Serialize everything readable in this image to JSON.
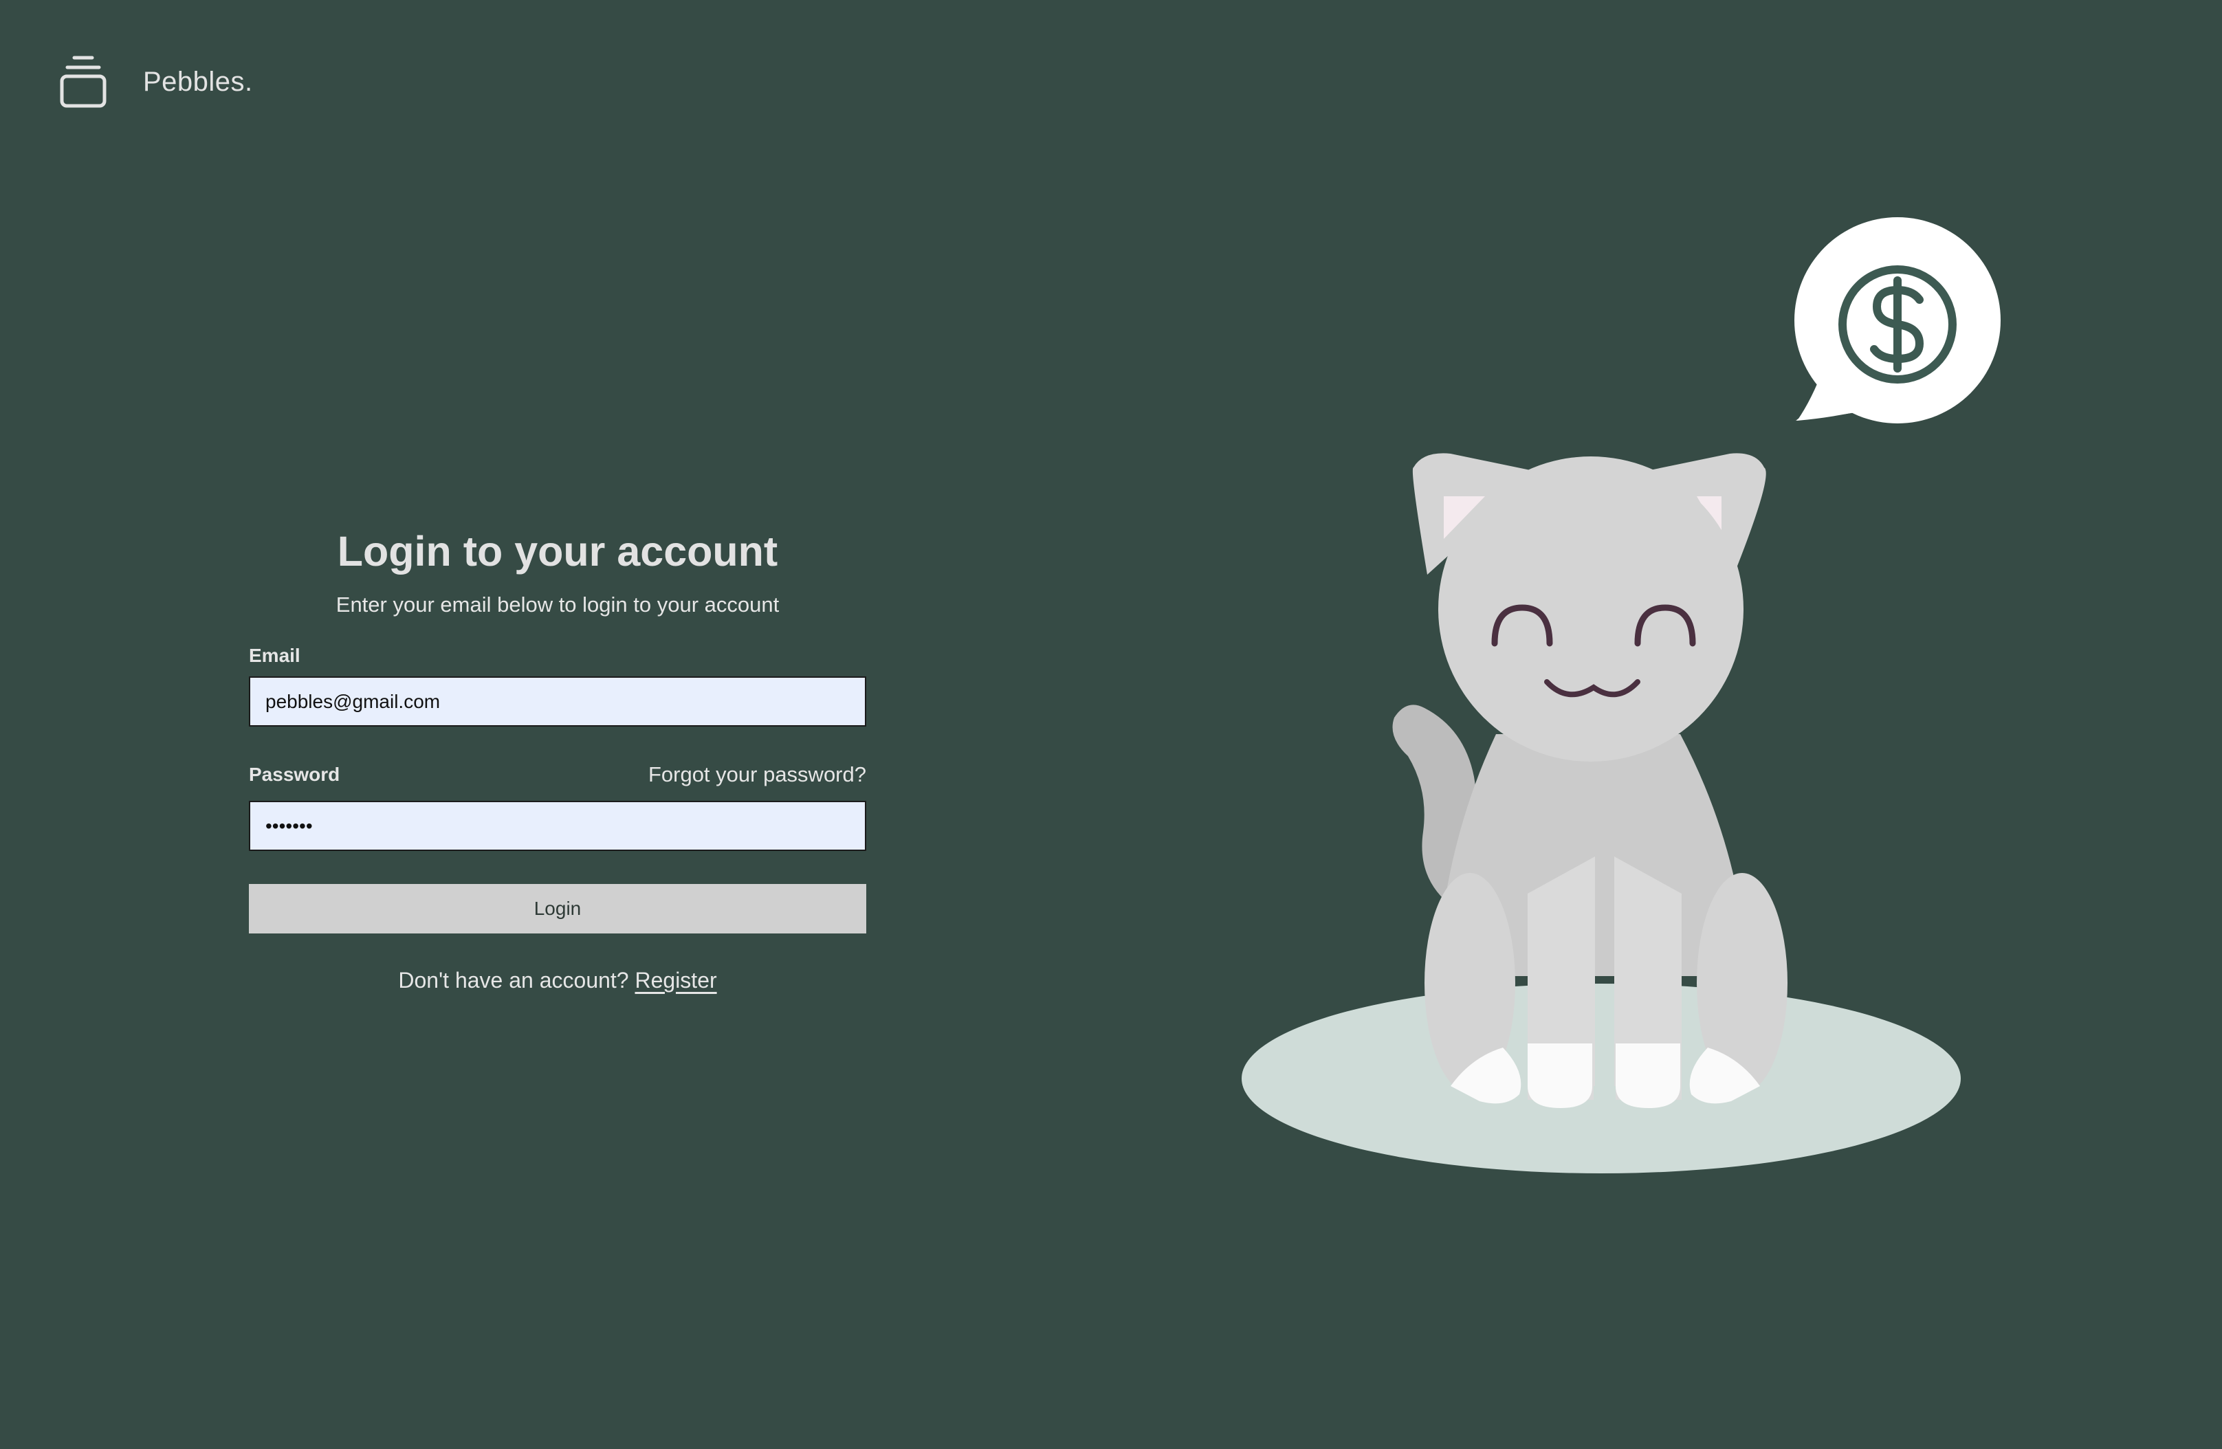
{
  "brand": {
    "name": "Pebbles.",
    "icon": "stack-icon"
  },
  "login": {
    "title": "Login to your account",
    "subtitle": "Enter your email below to login to your account",
    "email_label": "Email",
    "email_value": "pebbles@gmail.com",
    "password_label": "Password",
    "password_value": "*******",
    "forgot_link": "Forgot your password?",
    "login_button": "Login",
    "register_prompt": "Don't have an account?",
    "register_link": "Register"
  },
  "illustration": {
    "subject": "cat-with-dollar-speech-bubble",
    "icon": "dollar-icon"
  },
  "colors": {
    "background": "#364b45",
    "input_background": "#e8effd",
    "button_background": "#d0d0d0",
    "text_light": "#e6e6e6",
    "cat_gray": "#d4d4d4",
    "mat": "#cfdcd8",
    "speech_bubble": "#ffffff",
    "dollar_green": "#3d5a52"
  }
}
